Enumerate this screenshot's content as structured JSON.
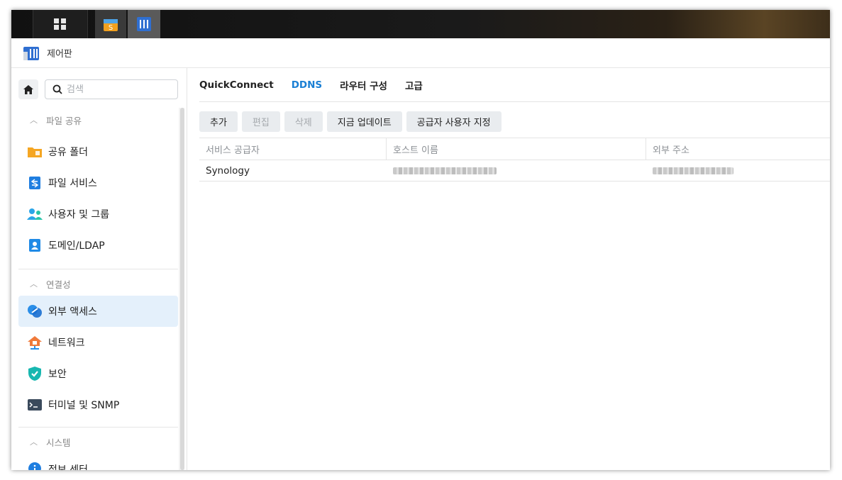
{
  "window": {
    "title": "제어판"
  },
  "sidebar": {
    "search_placeholder": "검색",
    "sections": [
      {
        "label": "파일 공유"
      },
      {
        "label": "연결성"
      },
      {
        "label": "시스템"
      }
    ],
    "items": [
      {
        "label": "공유 폴더",
        "icon": "shared-folder-icon"
      },
      {
        "label": "파일 서비스",
        "icon": "file-services-icon"
      },
      {
        "label": "사용자 및 그룹",
        "icon": "users-groups-icon"
      },
      {
        "label": "도메인/LDAP",
        "icon": "domain-ldap-icon"
      },
      {
        "label": "외부 액세스",
        "icon": "external-access-icon",
        "active": true
      },
      {
        "label": "네트워크",
        "icon": "network-icon"
      },
      {
        "label": "보안",
        "icon": "security-shield-icon"
      },
      {
        "label": "터미널 및 SNMP",
        "icon": "terminal-icon"
      },
      {
        "label": "정보 센터",
        "icon": "info-center-icon"
      }
    ]
  },
  "tabs": [
    {
      "label": "QuickConnect"
    },
    {
      "label": "DDNS",
      "active": true
    },
    {
      "label": "라우터 구성"
    },
    {
      "label": "고급"
    }
  ],
  "toolbar": {
    "add": "추가",
    "edit": "편집",
    "delete": "삭제",
    "update_now": "지금 업데이트",
    "customize_provider": "공급자 사용자 지정"
  },
  "table": {
    "columns": [
      "서비스 공급자",
      "호스트 이름",
      "외부 주소"
    ],
    "rows": [
      {
        "provider": "Synology"
      }
    ]
  },
  "colors": {
    "accent": "#1a7fd4",
    "active_bg": "#e4f0fb"
  }
}
